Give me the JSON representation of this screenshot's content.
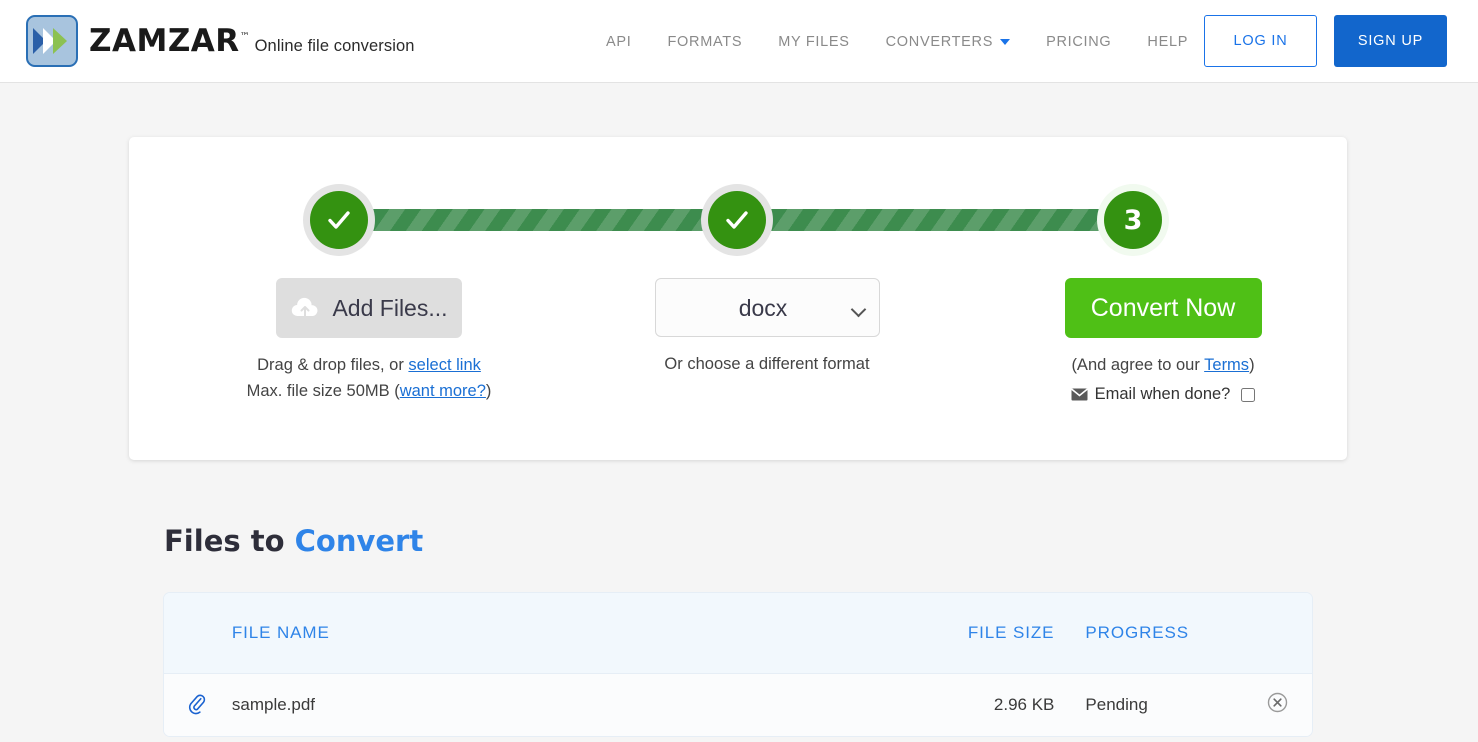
{
  "header": {
    "logo": {
      "word": "ZAMZAR",
      "tm": "™",
      "tagline": "Online file conversion",
      "icon": "zamzar-logo-icon"
    },
    "nav": [
      {
        "label": "API",
        "name": "nav-api"
      },
      {
        "label": "FORMATS",
        "name": "nav-formats"
      },
      {
        "label": "MY FILES",
        "name": "nav-my-files"
      },
      {
        "label": "CONVERTERS",
        "name": "nav-converters",
        "caret": true
      },
      {
        "label": "PRICING",
        "name": "nav-pricing"
      },
      {
        "label": "HELP",
        "name": "nav-help"
      }
    ],
    "login_label": "LOG IN",
    "signup_label": "SIGN UP"
  },
  "converter": {
    "steps": [
      {
        "state": "done",
        "glyph": "check-icon"
      },
      {
        "state": "done",
        "glyph": "check-icon"
      },
      {
        "state": "active",
        "number": "3"
      }
    ],
    "step1": {
      "button_label": "Add Files...",
      "button_icon": "cloud-upload-icon",
      "hint_prefix": "Drag & drop files, or ",
      "hint_link": "select link",
      "limit_prefix": "Max. file size 50MB (",
      "limit_link": "want more?",
      "limit_suffix": ")"
    },
    "step2": {
      "format_value": "docx",
      "format_options": [
        "docx"
      ],
      "caption": "Or choose a different format"
    },
    "step3": {
      "button_label": "Convert Now",
      "terms_prefix": "(And agree to our ",
      "terms_link": "Terms",
      "terms_suffix": ")",
      "email_icon": "envelope-icon",
      "email_label": "Email when done?",
      "email_checked": false
    }
  },
  "files": {
    "title_plain": "Files to ",
    "title_accent": "Convert",
    "columns": {
      "name": "FILE NAME",
      "size": "FILE SIZE",
      "progress": "PROGRESS"
    },
    "rows": [
      {
        "icon": "paperclip-icon",
        "name": "sample.pdf",
        "size": "2.96 KB",
        "progress": "Pending",
        "remove_icon": "circle-x-icon"
      }
    ]
  },
  "colors": {
    "brand_blue": "#1a73e8",
    "signup_blue": "#1266cc",
    "step_green": "#349211",
    "bar_green": "#3d8c4e",
    "convert_green": "#4fc016",
    "page_bg": "#f5f5f5",
    "table_header_bg": "#f2f8fd"
  }
}
